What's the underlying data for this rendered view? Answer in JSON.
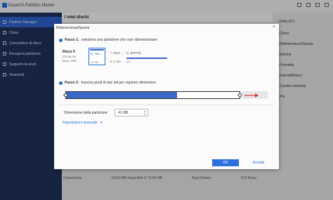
{
  "app": {
    "title": "EaseUS Partition Master",
    "sidebar": [
      {
        "label": "Partition Manager",
        "active": true
      },
      {
        "label": "Clona"
      },
      {
        "label": "Convertitore di disco"
      },
      {
        "label": "Recupera partizione"
      },
      {
        "label": "Supporto di avvio"
      },
      {
        "label": "Strumenti"
      }
    ],
    "main_title": "I miei dischi",
    "bottom_row": [
      "Dimensione",
      "19.60 MB disponibili di 79.66 MB",
      "Byte/Settore",
      "512 Bytes"
    ],
    "right_panel": {
      "header": "Unità (D:)",
      "items": [
        "Clona",
        "Ridimensiona/Sposta",
        "Elimina",
        "Formatta",
        "Estendi/Riduci",
        "Cambia etichetta",
        "Più"
      ]
    }
  },
  "dialog": {
    "title": "Ridimensiona/Sposta",
    "step1_prefix": "Passo 1:",
    "step1_text": "seleziona una partizione che vuoi ridimensionare",
    "disk": {
      "name": "Disco 0",
      "size": "232.88 GB",
      "type": "Base, MBR"
    },
    "partitions": [
      {
        "label": "D: sist...",
        "size": "41.28 ..."
      },
      {
        "label": "*: (Non ...",
        "size": "8.72 MB"
      },
      {
        "label": "C: (NTFS)",
        "size": "22..."
      }
    ],
    "step2_prefix": "Passo 2:",
    "step2_text": "trascina punti di due lati per regolare dimensioni",
    "partition_size_label": "Dimensione della partizione:",
    "partition_size_value": "41 MB",
    "advanced_label": "Impostazioni avanzate",
    "ok_label": "OK",
    "cancel_label": "Annulla",
    "used_fraction": 0.64
  },
  "colors": {
    "accent": "#2d6fe0",
    "sidebar": "#1e3058",
    "bar": "#3b67c9"
  }
}
